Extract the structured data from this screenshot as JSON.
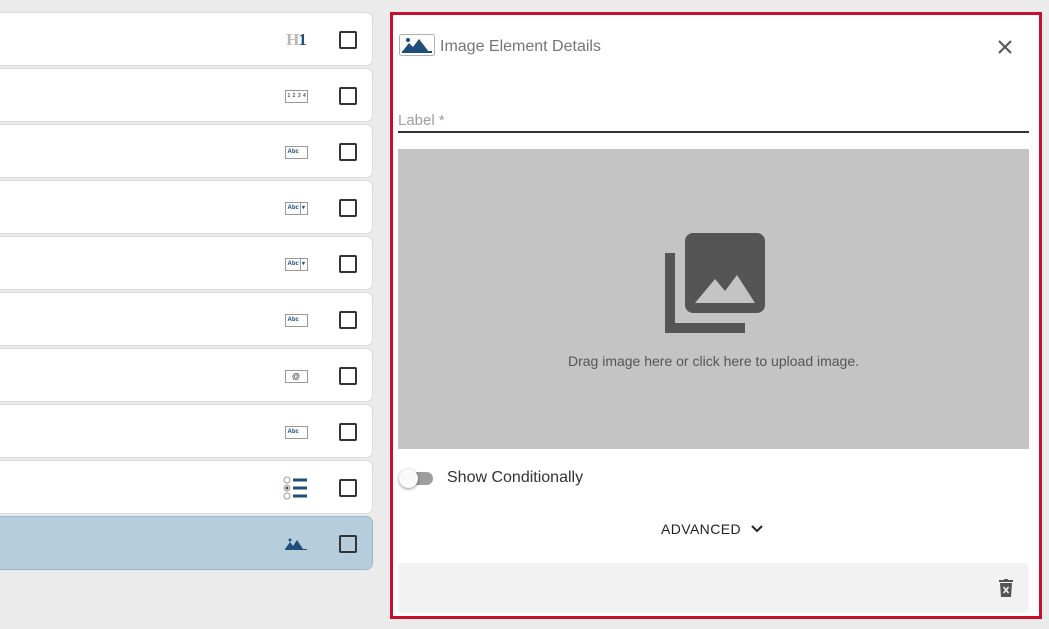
{
  "element_list": {
    "rows": [
      {
        "icon": "heading-icon",
        "icon_text_h": "H",
        "icon_text_1": "1",
        "selected": false
      },
      {
        "icon": "number-field-icon",
        "icon_text": "1 2 3 4",
        "selected": false
      },
      {
        "icon": "text-field-icon",
        "icon_text": "Abc",
        "selected": false
      },
      {
        "icon": "dropdown-field-icon",
        "icon_text": "Abc",
        "selected": false
      },
      {
        "icon": "dropdown-field-icon",
        "icon_text": "Abc",
        "selected": false
      },
      {
        "icon": "text-field-icon",
        "icon_text": "Abc",
        "selected": false
      },
      {
        "icon": "email-field-icon",
        "icon_text": "@",
        "selected": false
      },
      {
        "icon": "text-field-icon",
        "icon_text": "Abc",
        "selected": false
      },
      {
        "icon": "radio-list-icon",
        "selected": false
      },
      {
        "icon": "image-element-icon",
        "selected": true
      }
    ]
  },
  "details_panel": {
    "title": "Image Element Details",
    "label_placeholder": "Label *",
    "label_value": "",
    "dropzone_text": "Drag image here or click here to upload image.",
    "show_conditionally_label": "Show Conditionally",
    "show_conditionally_on": false,
    "advanced_label": "ADVANCED"
  },
  "colors": {
    "panel_border": "#c8102e",
    "selected_row": "#b6cddd",
    "brand_blue": "#1f4e79",
    "dropzone": "#c4c4c4"
  }
}
